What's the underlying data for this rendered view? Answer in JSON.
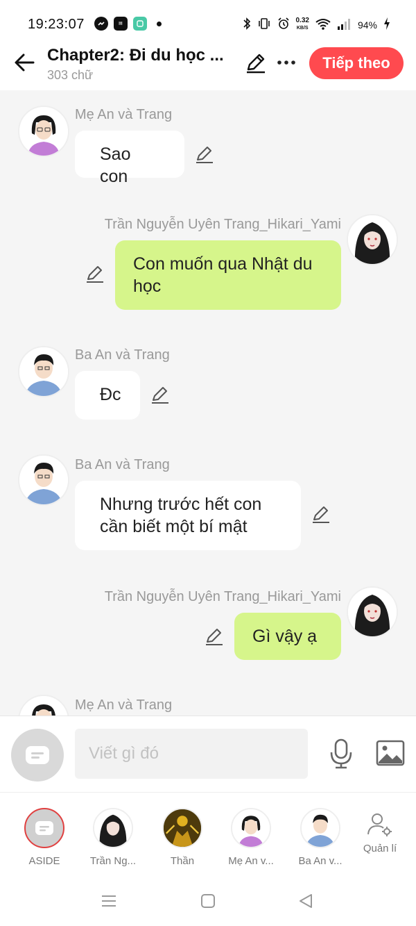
{
  "status_bar": {
    "time": "19:23:07",
    "net_speed_value": "0.32",
    "net_speed_unit": "KB/S",
    "battery": "94%"
  },
  "header": {
    "title": "Chapter2: Đi du học ...",
    "word_count": "303 chữ",
    "next_label": "Tiếp theo"
  },
  "messages": [
    {
      "sender": "Mẹ An và Trang",
      "text": "Sao con",
      "side": "left"
    },
    {
      "sender": "Trần Nguyễn Uyên Trang_Hikari_Yami",
      "text": "Con muốn qua Nhật du học",
      "side": "right"
    },
    {
      "sender": "Ba An và Trang",
      "text": "Đc",
      "side": "left"
    },
    {
      "sender": "Ba An và Trang",
      "text": "Nhưng trước hết con cần biết một bí mật",
      "side": "left"
    },
    {
      "sender": "Trần Nguyễn Uyên Trang_Hikari_Yami",
      "text": "Gì vậy ạ",
      "side": "right"
    },
    {
      "sender": "Mẹ An và Trang",
      "text": "",
      "side": "left"
    }
  ],
  "input": {
    "placeholder": "Viết gì đó"
  },
  "characters": [
    {
      "label": "ASIDE"
    },
    {
      "label": "Trần Ng..."
    },
    {
      "label": "Thần"
    },
    {
      "label": "Mẹ An v..."
    },
    {
      "label": "Ba An v..."
    },
    {
      "label": "Quản lí"
    }
  ],
  "colors": {
    "accent": "#ff4a4f",
    "right_bubble": "#d6f58b",
    "left_bubble": "#ffffff",
    "background": "#f5f5f5"
  }
}
